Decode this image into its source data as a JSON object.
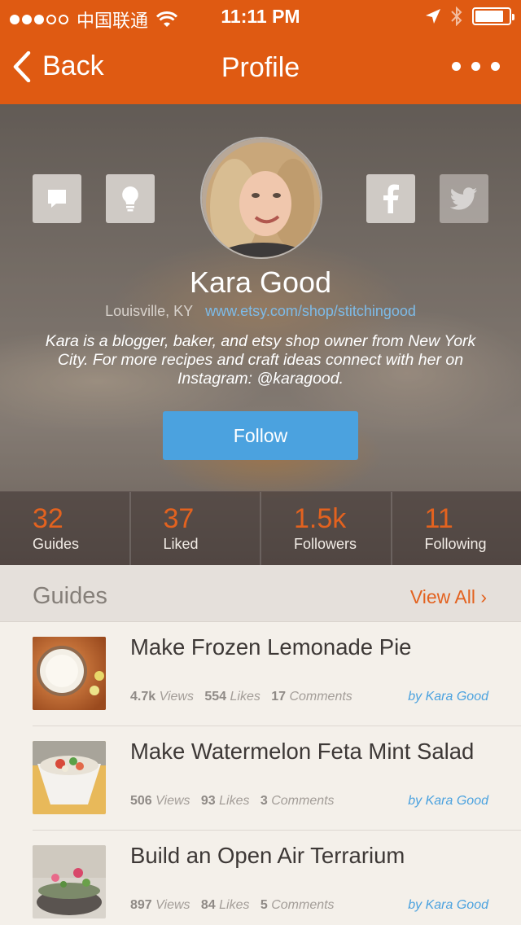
{
  "status": {
    "signal_bars": 5,
    "signal_filled": 3,
    "carrier": "中国联通",
    "time": "11:11 PM",
    "battery_level": 0.85
  },
  "nav": {
    "back_label": "Back",
    "title": "Profile"
  },
  "profile": {
    "name": "Kara Good",
    "location": "Louisville, KY",
    "website": "www.etsy.com/shop/stitchingood",
    "bio": "Kara is a blogger, baker, and etsy shop owner from New York City. For more recipes and craft ideas connect with her on Instagram: @karagood.",
    "follow_label": "Follow"
  },
  "stats": [
    {
      "value": "32",
      "label": "Guides"
    },
    {
      "value": "37",
      "label": "Liked"
    },
    {
      "value": "1.5k",
      "label": "Followers"
    },
    {
      "value": "11",
      "label": "Following"
    }
  ],
  "guides": {
    "title": "Guides",
    "view_all": "View All ›",
    "items": [
      {
        "title": "Make Frozen Lemonade Pie",
        "views": "4.7k",
        "likes": "554",
        "comments": "17",
        "author": "by Kara Good"
      },
      {
        "title": "Make Watermelon Feta Mint Salad",
        "views": "506",
        "likes": "93",
        "comments": "3",
        "author": "by Kara Good"
      },
      {
        "title": "Build an Open Air Terrarium",
        "views": "897",
        "likes": "84",
        "comments": "5",
        "author": "by Kara Good"
      }
    ],
    "views_word": "Views",
    "likes_word": "Likes",
    "comments_word": "Comments"
  },
  "colors": {
    "brand": "#df5a12",
    "accent_orange": "#e3621f",
    "link_blue": "#4ba2df"
  }
}
